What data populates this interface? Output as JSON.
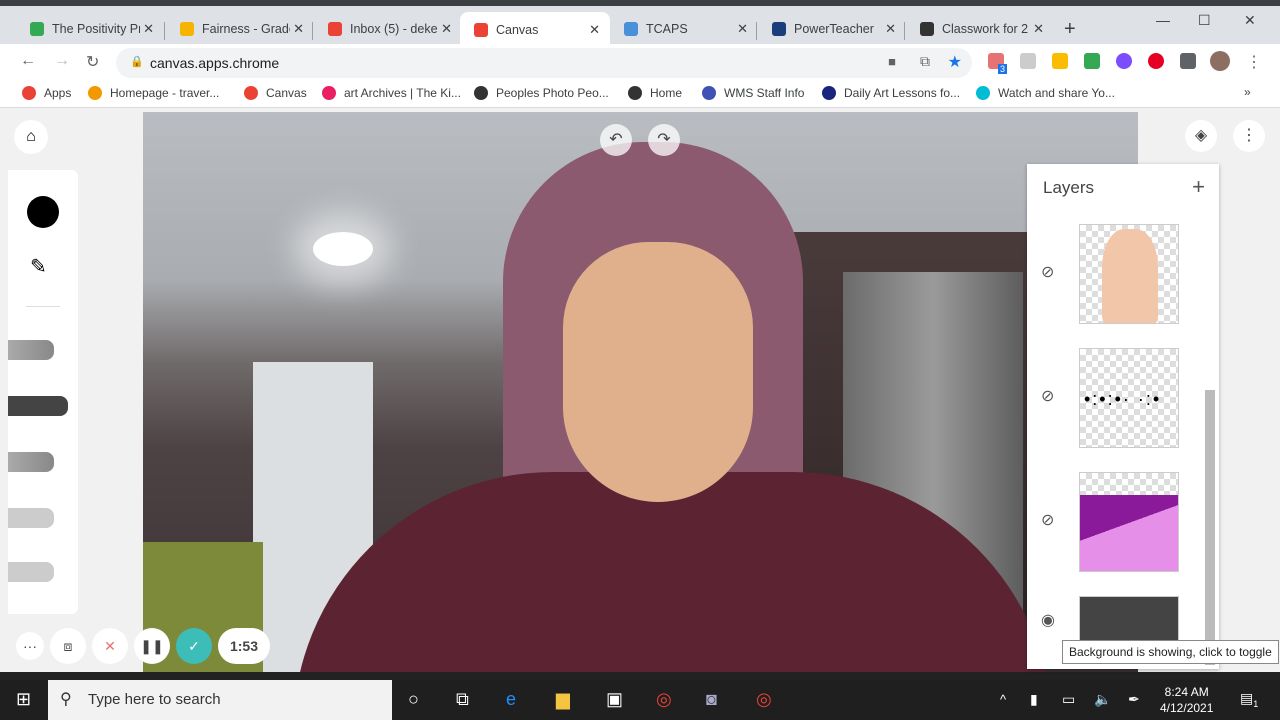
{
  "browser": {
    "tabs": [
      {
        "label": "The Positivity Pr",
        "color": "#34a853"
      },
      {
        "label": "Fairness - Grade",
        "color": "#f4b400"
      },
      {
        "label": "Inbox (5) - deke",
        "color": "#ea4335"
      },
      {
        "label": "Canvas",
        "color": "#ea4335",
        "active": true
      },
      {
        "label": "TCAPS",
        "color": "#4a90d9"
      },
      {
        "label": "PowerTeacher",
        "color": "#1a3d7c"
      },
      {
        "label": "Classwork for 2",
        "color": "#333333"
      }
    ],
    "close_glyph": "✕",
    "new_tab": "+",
    "url": "canvas.apps.chrome",
    "extension_badge": "3",
    "bookmarks": [
      {
        "label": "Apps",
        "color": "#ea4335"
      },
      {
        "label": "Homepage - traver...",
        "color": "#f29900"
      },
      {
        "label": "Canvas",
        "color": "#ea4335"
      },
      {
        "label": "art Archives | The Ki...",
        "color": "#e91e63"
      },
      {
        "label": "Peoples Photo Peo...",
        "color": "#333333"
      },
      {
        "label": "Home",
        "color": "#333333"
      },
      {
        "label": "WMS Staff Info",
        "color": "#3f51b5"
      },
      {
        "label": "Daily Art Lessons fo...",
        "color": "#1a237e"
      },
      {
        "label": "Watch and share Yo...",
        "color": "#00bcd4"
      }
    ],
    "bookmarks_more": "»"
  },
  "canvas": {
    "timer": "1:53",
    "brush_color": "#000000",
    "accent": "#3dbdb7",
    "layers_title": "Layers",
    "add_layer": "+",
    "layers": [
      {
        "name": "face",
        "visible": false
      },
      {
        "name": "dots",
        "visible": false
      },
      {
        "name": "purple shapes",
        "visible": false
      },
      {
        "name": "background",
        "visible": true
      }
    ],
    "tooltip": "Background is showing, click to toggle"
  },
  "taskbar": {
    "search_placeholder": "Type here to search",
    "time": "8:24 AM",
    "date": "4/12/2021",
    "notifications": "1"
  }
}
